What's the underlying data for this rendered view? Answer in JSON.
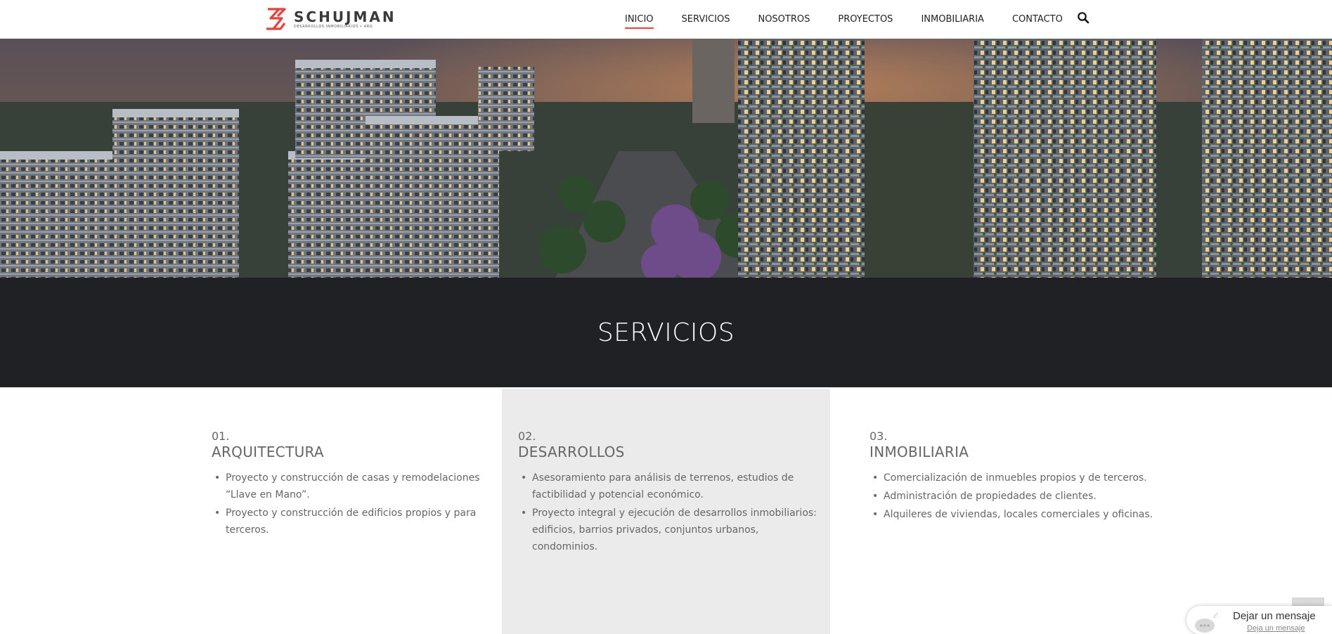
{
  "brand": {
    "name": "SCHUJMAN",
    "tagline": "DESARROLLOS INMOBILIARIOS • ARQ",
    "accent_color": "#e8423b"
  },
  "nav": {
    "items": [
      {
        "label": "INICIO",
        "active": true
      },
      {
        "label": "SERVICIOS",
        "active": false
      },
      {
        "label": "NOSOTROS",
        "active": false
      },
      {
        "label": "PROYECTOS",
        "active": false
      },
      {
        "label": "INMOBILIARIA",
        "active": false
      },
      {
        "label": "CONTACTO",
        "active": false
      }
    ],
    "search_icon": "search-icon"
  },
  "banner": {
    "title": "SERVICIOS"
  },
  "services": [
    {
      "number": "01.",
      "title": "ARQUITECTURA",
      "items": [
        "Proyecto y construcción de casas y remodelaciones “Llave en Mano”.",
        "Proyecto y construcción de edificios propios y para terceros."
      ]
    },
    {
      "number": "02.",
      "title": "DESARROLLOS",
      "items": [
        "Asesoramiento para análisis de terrenos, estudios de factibilidad y potencial económico.",
        "Proyecto integral y ejecución de desarrollos inmobiliarios: edificios, barrios privados, conjuntos urbanos, condominios."
      ]
    },
    {
      "number": "03.",
      "title": "INMOBILIARIA",
      "items": [
        "Comercialización de inmuebles propios y de terceros.",
        "Administración de propiedades de clientes.",
        "Alquileres de viviendas, locales comerciales y oficinas."
      ]
    }
  ],
  "chat": {
    "title": "Dejar un mensaje",
    "subtitle": "Deja un mensaje"
  }
}
